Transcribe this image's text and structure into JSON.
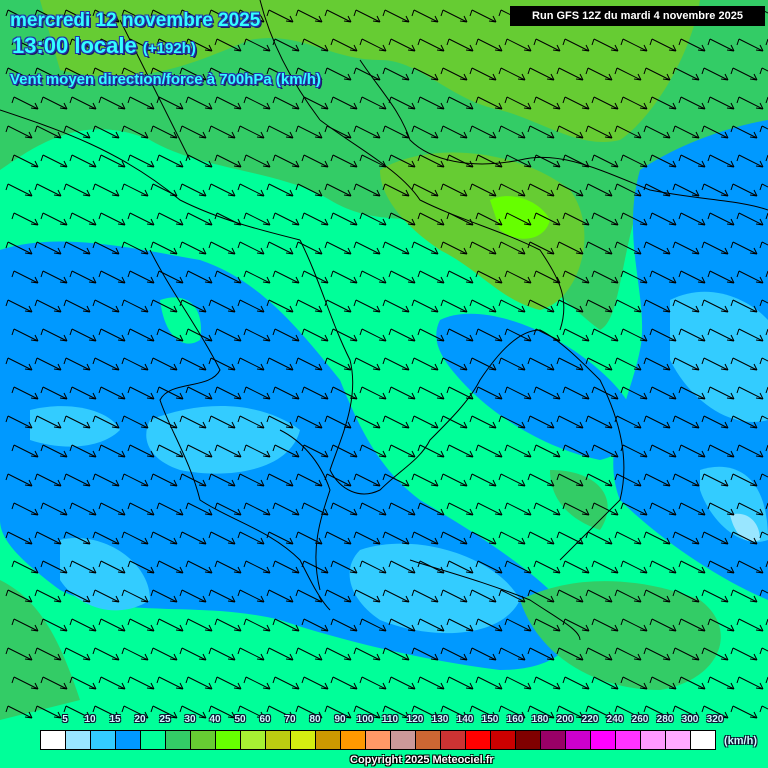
{
  "header": {
    "date": "mercredi 12 novembre 2025",
    "time": "13:00 locale",
    "lead": "(+192h)",
    "parameter": "Vent moyen direction/force à 700hPa (km/h)",
    "run": "Run GFS 12Z du mardi 4 novembre 2025"
  },
  "legend": {
    "labels": [
      "5",
      "10",
      "15",
      "20",
      "25",
      "30",
      "40",
      "50",
      "60",
      "70",
      "80",
      "90",
      "100",
      "110",
      "120",
      "130",
      "140",
      "150",
      "160",
      "180",
      "200",
      "220",
      "240",
      "260",
      "280",
      "300",
      "320"
    ],
    "colors": [
      "#ffffff",
      "#99e6ff",
      "#33ccff",
      "#0099ff",
      "#00ff99",
      "#33cc66",
      "#66cc33",
      "#66ff00",
      "#a6f033",
      "#bbcc11",
      "#d4ee11",
      "#cc9900",
      "#ff9900",
      "#ff9966",
      "#cc9999",
      "#cc6633",
      "#cc3333",
      "#ff0000",
      "#cc0000",
      "#800000",
      "#990066",
      "#cc00cc",
      "#ff00ff",
      "#ff33ff",
      "#ff99ff",
      "#ffaaff",
      "#ffffff"
    ],
    "unit": "(km/h)"
  },
  "wind_direction": "northwest",
  "copyright": "Copyright 2025 Meteociel.fr"
}
